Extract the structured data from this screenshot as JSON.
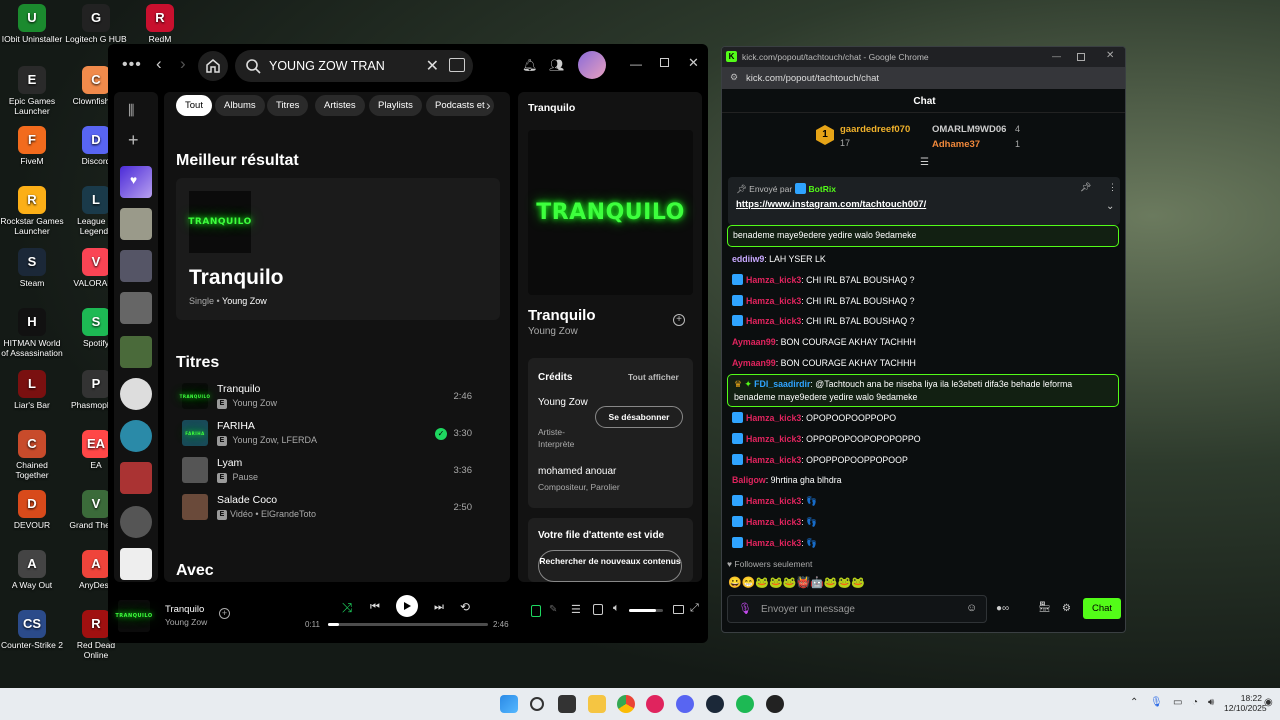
{
  "desktop": {
    "icons": [
      {
        "label": "IObit Uninstaller",
        "color": "#1b8a2e",
        "glyph": "U"
      },
      {
        "label": "Logitech G HUB",
        "color": "#222",
        "glyph": "G"
      },
      {
        "label": "RedM",
        "color": "#c8102e",
        "glyph": "R"
      },
      {
        "label": "Epic Games Launcher",
        "color": "#2a2a2a",
        "glyph": "E"
      },
      {
        "label": "ClownfishVo",
        "color": "#f08a4b",
        "glyph": "C"
      },
      {
        "label": "FiveM",
        "color": "#f26b1d",
        "glyph": "F"
      },
      {
        "label": "Discord",
        "color": "#5865f2",
        "glyph": "D"
      },
      {
        "label": "Rockstar Games Launcher",
        "color": "#fcaf17",
        "glyph": "R"
      },
      {
        "label": "League of Legends",
        "color": "#1a3a4a",
        "glyph": "L"
      },
      {
        "label": "Steam",
        "color": "#1b2838",
        "glyph": "S"
      },
      {
        "label": "VALORANT",
        "color": "#fa4454",
        "glyph": "V"
      },
      {
        "label": "HITMAN World of Assassination",
        "color": "#111",
        "glyph": "H"
      },
      {
        "label": "Spotify",
        "color": "#1db954",
        "glyph": "S"
      },
      {
        "label": "Liar's Bar",
        "color": "#7a1010",
        "glyph": "L"
      },
      {
        "label": "Phasmophob",
        "color": "#333",
        "glyph": "P"
      },
      {
        "label": "Chained Together",
        "color": "#c84b2b",
        "glyph": "C"
      },
      {
        "label": "EA",
        "color": "#ff4747",
        "glyph": "EA"
      },
      {
        "label": "DEVOUR",
        "color": "#d84a1b",
        "glyph": "D"
      },
      {
        "label": "Grand Theft V",
        "color": "#3b6b3a",
        "glyph": "V"
      },
      {
        "label": "A Way Out",
        "color": "#444",
        "glyph": "A"
      },
      {
        "label": "AnyDesk",
        "color": "#ef443b",
        "glyph": "A"
      },
      {
        "label": "Counter-Strike 2",
        "color": "#2b4b8a",
        "glyph": "CS"
      },
      {
        "label": "Red Dead Online",
        "color": "#a01010",
        "glyph": "R"
      }
    ]
  },
  "spotify": {
    "search_value": "YOUNG ZOW TRAN",
    "chips": [
      "Tout",
      "Albums",
      "Titres",
      "Artistes",
      "Playlists",
      "Podcasts et"
    ],
    "best_result_heading": "Meilleur résultat",
    "best": {
      "title": "Tranquilo",
      "type": "Single",
      "artist": "Young Zow",
      "art_text": "TRANQUILO"
    },
    "tracks_heading": "Titres",
    "tracks": [
      {
        "title": "Tranquilo",
        "artists": "Young Zow",
        "duration": "2:46",
        "explicit": "E",
        "video": "",
        "added": false,
        "art_text": "TRANQUILO"
      },
      {
        "title": "FARIHA",
        "artists": "Young Zow, LFERDA",
        "duration": "3:30",
        "explicit": "E",
        "video": "",
        "added": true,
        "art_text": "FARIHA"
      },
      {
        "title": "Lyam",
        "artists": "Pause",
        "duration": "3:36",
        "explicit": "E",
        "video": "",
        "added": false,
        "art_text": ""
      },
      {
        "title": "Salade Coco",
        "artists": "ElGrandeToto",
        "duration": "2:50",
        "explicit": "E",
        "video": "Vidéo •",
        "added": false,
        "art_text": ""
      }
    ],
    "with_heading": "Avec",
    "right": {
      "header": "Tranquilo",
      "art_text": "TRANQUILO",
      "title": "Tranquilo",
      "artist": "Young Zow",
      "credits_heading": "Crédits",
      "show_all": "Tout afficher",
      "credit1_name": "Young Zow",
      "credit1_role": "Artiste-Interprète",
      "unfollow": "Se désabonner",
      "credit2_name": "mohamed anouar",
      "credit2_role": "Compositeur, Parolier",
      "queue_heading": "Votre file d'attente est vide",
      "queue_button": "Rechercher de nouveaux contenus"
    },
    "player": {
      "title": "Tranquilo",
      "artist": "Young Zow",
      "elapsed": "0:11",
      "total": "2:46",
      "progress": 0.066,
      "volume": 0.8,
      "art_text": "TRANQUILO"
    }
  },
  "chrome": {
    "title": "kick.com/popout/tachtouch/chat - Google Chrome",
    "url": "kick.com/popout/tachtouch/chat",
    "chat_header": "Chat",
    "leaders": {
      "first_name": "gaardedreef070",
      "first_rank": "1",
      "first_count": "17",
      "second_name": "OMARLM9WD06",
      "second_count": "4",
      "third_name": "Adhame37",
      "third_count": "1"
    },
    "pinned": {
      "sent_by": "Envoyé par",
      "bot": "BotRix",
      "link": "https://www.instagram.com/tachtouch007/"
    },
    "messages": [
      {
        "user": "eddiiw9",
        "text": "LAH YSER LK",
        "badge": false,
        "style": "u2"
      },
      {
        "user": "Hamza_kick3",
        "text": "CHI IRL B7AL BOUSHAQ ?",
        "badge": true,
        "style": "u"
      },
      {
        "user": "Hamza_kick3",
        "text": "CHI IRL B7AL BOUSHAQ ?",
        "badge": true,
        "style": "u"
      },
      {
        "user": "Hamza_kick3",
        "text": "CHI IRL B7AL BOUSHAQ ?",
        "badge": true,
        "style": "u"
      },
      {
        "user": "Aymaan99",
        "text": "BON COURAGE AKHAY TACHHH",
        "badge": false,
        "style": "u"
      },
      {
        "user": "Aymaan99",
        "text": "BON COURAGE AKHAY TACHHH",
        "badge": false,
        "style": "u"
      }
    ],
    "highlight_top": {
      "text": "benademe maye9edere yedire walo 9edameke"
    },
    "highlight": {
      "user": "FDI_saadirdir",
      "text": "@Tachtouch ana be niseba liya ila le3ebeti difa3e behade leforma benademe maye9edere yedire walo 9edameke"
    },
    "messages2": [
      {
        "user": "Hamza_kick3",
        "text": "OPOPOOPOOPPOPO",
        "badge": true
      },
      {
        "user": "Hamza_kick3",
        "text": "OPPOPOPOOPOPOPOPPO",
        "badge": true
      },
      {
        "user": "Hamza_kick3",
        "text": "OPOPPOPOOPPOPOOP",
        "badge": true
      },
      {
        "user": "Baligow",
        "text": "9hrtina gha blhdra",
        "badge": false
      },
      {
        "user": "Hamza_kick3",
        "text": "👣",
        "badge": true
      },
      {
        "user": "Hamza_kick3",
        "text": "👣",
        "badge": true
      },
      {
        "user": "Hamza_kick3",
        "text": "👣",
        "badge": true
      }
    ],
    "followers_only": "Followers seulement",
    "input_placeholder": "Envoyer un message",
    "send_label": "Chat"
  },
  "taskbar": {
    "time": "18:22",
    "date": "12/10/2025"
  }
}
